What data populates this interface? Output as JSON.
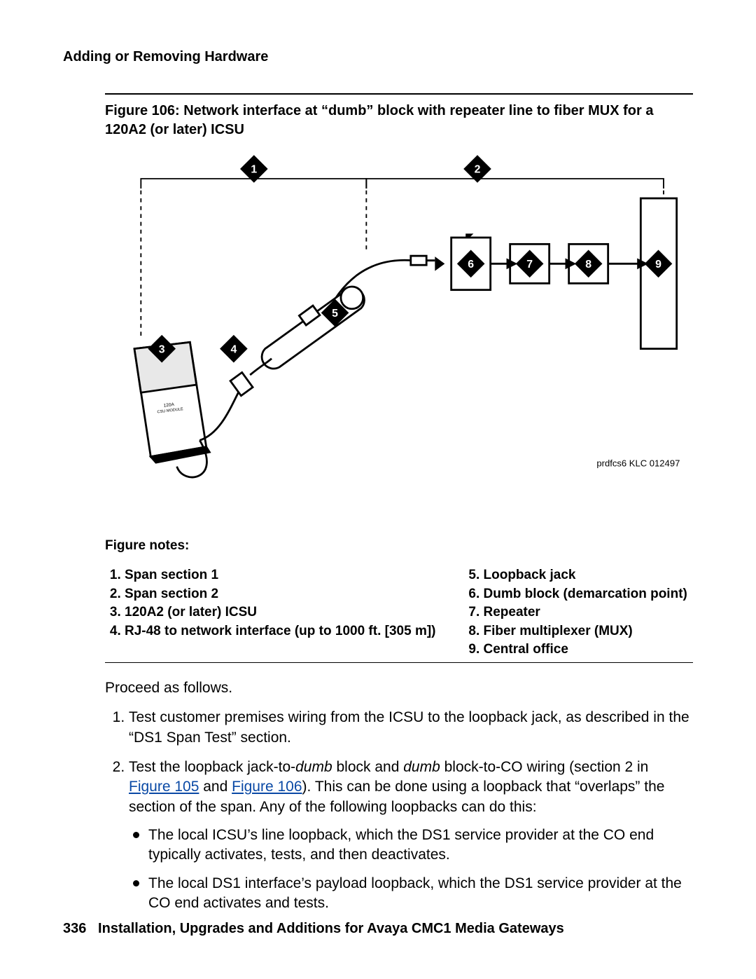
{
  "header": {
    "running": "Adding or Removing Hardware"
  },
  "figure": {
    "caption": "Figure 106: Network interface at “dumb” block with repeater line to fiber MUX for a 120A2 (or later) ICSU",
    "attribution": "prdfcs6 KLC 012497",
    "callouts": {
      "c1": "1",
      "c2": "2",
      "c3": "3",
      "c4": "4",
      "c5": "5",
      "c6": "6",
      "c7": "7",
      "c8": "8",
      "c9": "9"
    },
    "icsu_label_1": "120A",
    "icsu_label_2": "CSU MODULE",
    "notes_label": "Figure notes:",
    "notes_left": [
      "Span section 1",
      "Span section 2",
      "120A2 (or later) ICSU",
      "RJ-48 to network interface (up to 1000 ft. [305 m])"
    ],
    "notes_right": [
      "Loopback jack",
      "Dumb block (demarcation point)",
      "Repeater",
      "Fiber multiplexer (MUX)",
      "Central office"
    ]
  },
  "body": {
    "intro": "Proceed as follows.",
    "step1": "Test customer premises wiring from the ICSU to the loopback jack, as described in the “DS1 Span Test” section.",
    "step2_a": "Test the loopback jack-to-",
    "step2_b": "dumb",
    "step2_c": " block and ",
    "step2_d": "dumb",
    "step2_e": " block-to-CO wiring (section 2 in ",
    "step2_link1": "Figure 105",
    "step2_f": " and ",
    "step2_link2": "Figure 106",
    "step2_g": "). This can be done using a loopback that “overlaps” the section of the span. Any of the following loopbacks can do this:",
    "bullet1": "The local ICSU’s line loopback, which the DS1 service provider at the CO end typically activates, tests, and then deactivates.",
    "bullet2": "The local DS1 interface’s payload loopback, which the DS1 service provider at the CO end activates and tests."
  },
  "footer": {
    "page": "336",
    "title": "Installation, Upgrades and Additions for Avaya CMC1 Media Gateways"
  }
}
